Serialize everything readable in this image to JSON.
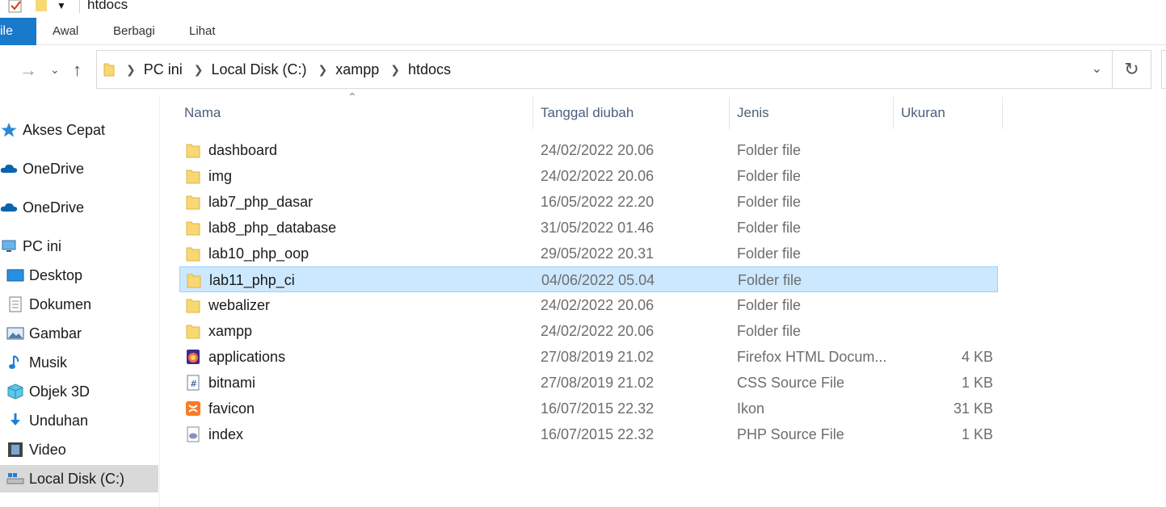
{
  "window": {
    "title": "htdocs"
  },
  "ribbon": {
    "tabs": [
      "ile",
      "Awal",
      "Berbagi",
      "Lihat"
    ]
  },
  "address": {
    "breadcrumbs": [
      "PC ini",
      "Local Disk (C:)",
      "xampp",
      "htdocs"
    ]
  },
  "sidebar": {
    "items": [
      {
        "label": "Akses Cepat",
        "icon": "star-icon"
      },
      {
        "label": "OneDrive",
        "icon": "cloud-icon"
      },
      {
        "label": "OneDrive",
        "icon": "cloud-icon"
      },
      {
        "label": "PC ini",
        "icon": "computer-icon"
      },
      {
        "label": "Desktop",
        "icon": "desktop-icon"
      },
      {
        "label": "Dokumen",
        "icon": "document-icon"
      },
      {
        "label": "Gambar",
        "icon": "picture-icon"
      },
      {
        "label": "Musik",
        "icon": "music-icon"
      },
      {
        "label": "Objek 3D",
        "icon": "cube-icon"
      },
      {
        "label": "Unduhan",
        "icon": "download-icon"
      },
      {
        "label": "Video",
        "icon": "video-icon"
      },
      {
        "label": "Local Disk (C:)",
        "icon": "drive-icon"
      }
    ],
    "selected": "Local Disk (C:)"
  },
  "columns": {
    "name": "Nama",
    "date": "Tanggal diubah",
    "type": "Jenis",
    "size": "Ukuran"
  },
  "files": [
    {
      "name": "dashboard",
      "date": "24/02/2022 20.06",
      "type": "Folder file",
      "size": "",
      "icon": "folder-icon"
    },
    {
      "name": "img",
      "date": "24/02/2022 20.06",
      "type": "Folder file",
      "size": "",
      "icon": "folder-icon"
    },
    {
      "name": "lab7_php_dasar",
      "date": "16/05/2022 22.20",
      "type": "Folder file",
      "size": "",
      "icon": "folder-icon"
    },
    {
      "name": "lab8_php_database",
      "date": "31/05/2022 01.46",
      "type": "Folder file",
      "size": "",
      "icon": "folder-icon"
    },
    {
      "name": "lab10_php_oop",
      "date": "29/05/2022 20.31",
      "type": "Folder file",
      "size": "",
      "icon": "folder-icon"
    },
    {
      "name": "lab11_php_ci",
      "date": "04/06/2022 05.04",
      "type": "Folder file",
      "size": "",
      "icon": "folder-icon"
    },
    {
      "name": "webalizer",
      "date": "24/02/2022 20.06",
      "type": "Folder file",
      "size": "",
      "icon": "folder-icon"
    },
    {
      "name": "xampp",
      "date": "24/02/2022 20.06",
      "type": "Folder file",
      "size": "",
      "icon": "folder-icon"
    },
    {
      "name": "applications",
      "date": "27/08/2019 21.02",
      "type": "Firefox HTML Docum...",
      "size": "4 KB",
      "icon": "firefox-html-icon"
    },
    {
      "name": "bitnami",
      "date": "27/08/2019 21.02",
      "type": "CSS Source File",
      "size": "1 KB",
      "icon": "css-file-icon"
    },
    {
      "name": "favicon",
      "date": "16/07/2015 22.32",
      "type": "Ikon",
      "size": "31 KB",
      "icon": "xampp-icon"
    },
    {
      "name": "index",
      "date": "16/07/2015 22.32",
      "type": "PHP Source File",
      "size": "1 KB",
      "icon": "php-file-icon"
    }
  ],
  "selected_file": "lab11_php_ci",
  "colors": {
    "accent": "#1979ca",
    "selection": "#cce8ff",
    "selection_border": "#99d1ff",
    "folder": "#f8d775"
  }
}
